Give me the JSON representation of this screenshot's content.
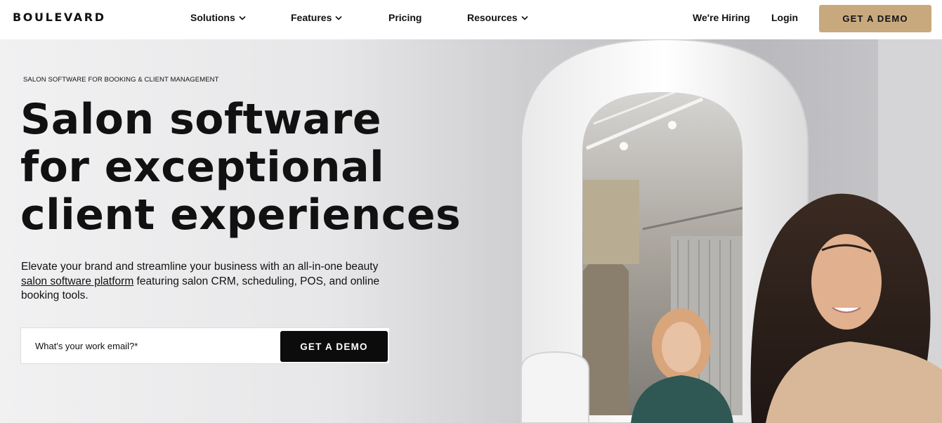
{
  "brand": {
    "logo_text": "BOULEVARD"
  },
  "nav": {
    "items": [
      {
        "label": "Solutions",
        "has_dropdown": true
      },
      {
        "label": "Features",
        "has_dropdown": true
      },
      {
        "label": "Pricing",
        "has_dropdown": false
      },
      {
        "label": "Resources",
        "has_dropdown": true
      }
    ],
    "hiring_label": "We're Hiring",
    "login_label": "Login",
    "cta_label": "GET A DEMO"
  },
  "hero": {
    "eyebrow": "SALON SOFTWARE FOR BOOKING & CLIENT MANAGEMENT",
    "headline_lines": [
      "Salon software",
      "for exceptional",
      "client experiences"
    ],
    "subcopy_before_link": "Elevate your brand and streamline your business with an all-in-one beauty ",
    "subcopy_link": "salon software platform",
    "subcopy_after_link": " featuring salon CRM, scheduling, POS, and online booking tools.",
    "email_placeholder": "What's your work email?*",
    "cta_label": "GET A DEMO"
  },
  "colors": {
    "accent": "#c8a97e",
    "dark_button": "#0c0c0c"
  }
}
